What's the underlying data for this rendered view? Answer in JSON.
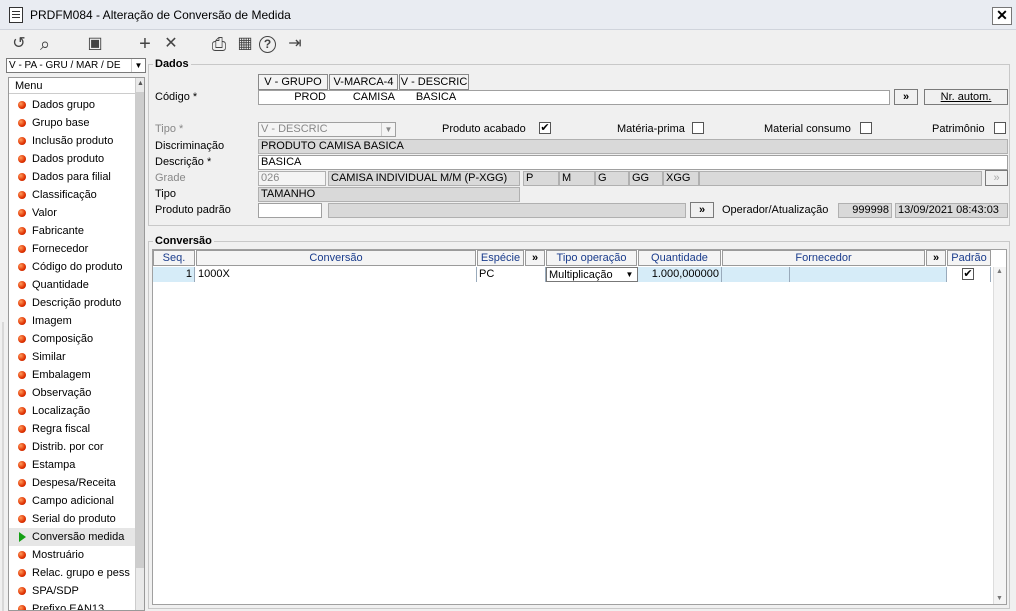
{
  "window": {
    "title": "PRDFM084 - Alteração de Conversão de Medida",
    "close": "✕"
  },
  "toolbar": [
    {
      "name": "undo-icon",
      "glyph": "↺"
    },
    {
      "name": "search-icon",
      "glyph": "⌕"
    },
    {
      "name": "save-icon",
      "glyph": "▣"
    },
    {
      "name": "add-icon",
      "glyph": "+"
    },
    {
      "name": "delete-icon",
      "glyph": "✕"
    },
    {
      "name": "print-icon",
      "glyph": "⎙"
    },
    {
      "name": "calendar-icon",
      "glyph": "▦"
    },
    {
      "name": "help-icon",
      "glyph": "?"
    },
    {
      "name": "exit-icon",
      "glyph": "⇥"
    }
  ],
  "nav_combo": {
    "value": "V - PA - GRU / MAR / DE"
  },
  "menu": {
    "header": "Menu",
    "items": [
      {
        "label": "Dados grupo"
      },
      {
        "label": "Grupo base"
      },
      {
        "label": "Inclusão produto"
      },
      {
        "label": "Dados produto"
      },
      {
        "label": "Dados para filial"
      },
      {
        "label": "Classificação"
      },
      {
        "label": "Valor"
      },
      {
        "label": "Fabricante"
      },
      {
        "label": "Fornecedor"
      },
      {
        "label": "Código do produto"
      },
      {
        "label": "Quantidade"
      },
      {
        "label": "Descrição produto"
      },
      {
        "label": "Imagem"
      },
      {
        "label": "Composição"
      },
      {
        "label": "Similar"
      },
      {
        "label": "Embalagem"
      },
      {
        "label": "Observação"
      },
      {
        "label": "Localização"
      },
      {
        "label": "Regra fiscal"
      },
      {
        "label": "Distrib. por cor"
      },
      {
        "label": "Estampa"
      },
      {
        "label": "Despesa/Receita"
      },
      {
        "label": "Campo adicional"
      },
      {
        "label": "Serial do produto"
      },
      {
        "label": "Conversão medida",
        "selected": true
      },
      {
        "label": "Mostruário"
      },
      {
        "label": "Relac. grupo e pess"
      },
      {
        "label": "SPA/SDP"
      },
      {
        "label": "Prefixo EAN13"
      }
    ]
  },
  "dados": {
    "title": "Dados",
    "codigo": {
      "label": "Código *",
      "col_headers": [
        "V - GRUPO",
        "V-MARCA-4",
        "V - DESCRIC"
      ],
      "values": [
        "PROD",
        "CAMISA",
        "BASICA"
      ],
      "more_button": "»",
      "auto_button": "Nr. autom."
    },
    "tipo": {
      "label": "Tipo *",
      "value": "V - DESCRIC"
    },
    "produto_acabado": {
      "label": "Produto acabado",
      "checked": true
    },
    "materia_prima": {
      "label": "Matéria-prima",
      "checked": false
    },
    "material_consumo": {
      "label": "Material consumo",
      "checked": false
    },
    "patrimonio": {
      "label": "Patrimônio",
      "checked": false
    },
    "discriminacao": {
      "label": "Discriminação",
      "value": "PRODUTO CAMISA BASICA"
    },
    "descricao": {
      "label": "Descrição *",
      "value": "BASICA"
    },
    "grade": {
      "label": "Grade",
      "code": "026",
      "desc": "CAMISA INDIVIDUAL M/M (P-XGG)",
      "sizes": [
        "P",
        "M",
        "G",
        "GG",
        "XGG"
      ],
      "btn": "»"
    },
    "tipo2": {
      "label": "Tipo",
      "value": "TAMANHO"
    },
    "produto_padrao": {
      "label": "Produto padrão",
      "value": "",
      "desc": "",
      "btn": "»"
    },
    "operador": {
      "label": "Operador/Atualização",
      "user": "999998",
      "datetime": "13/09/2021 08:43:03"
    }
  },
  "conversao": {
    "title": "Conversão",
    "columns": [
      "Seq.",
      "Conversão",
      "Espécie",
      "»",
      "Tipo operação",
      "Quantidade",
      "Fornecedor",
      "»",
      "Padrão"
    ],
    "rows": [
      {
        "seq": "1",
        "conversao": "1000X",
        "especie": "PC",
        "tipo_operacao": "Multiplicação",
        "quantidade": "1.000,000000",
        "fornecedor": "",
        "fornecedor_desc": "",
        "padrao": true
      }
    ]
  }
}
